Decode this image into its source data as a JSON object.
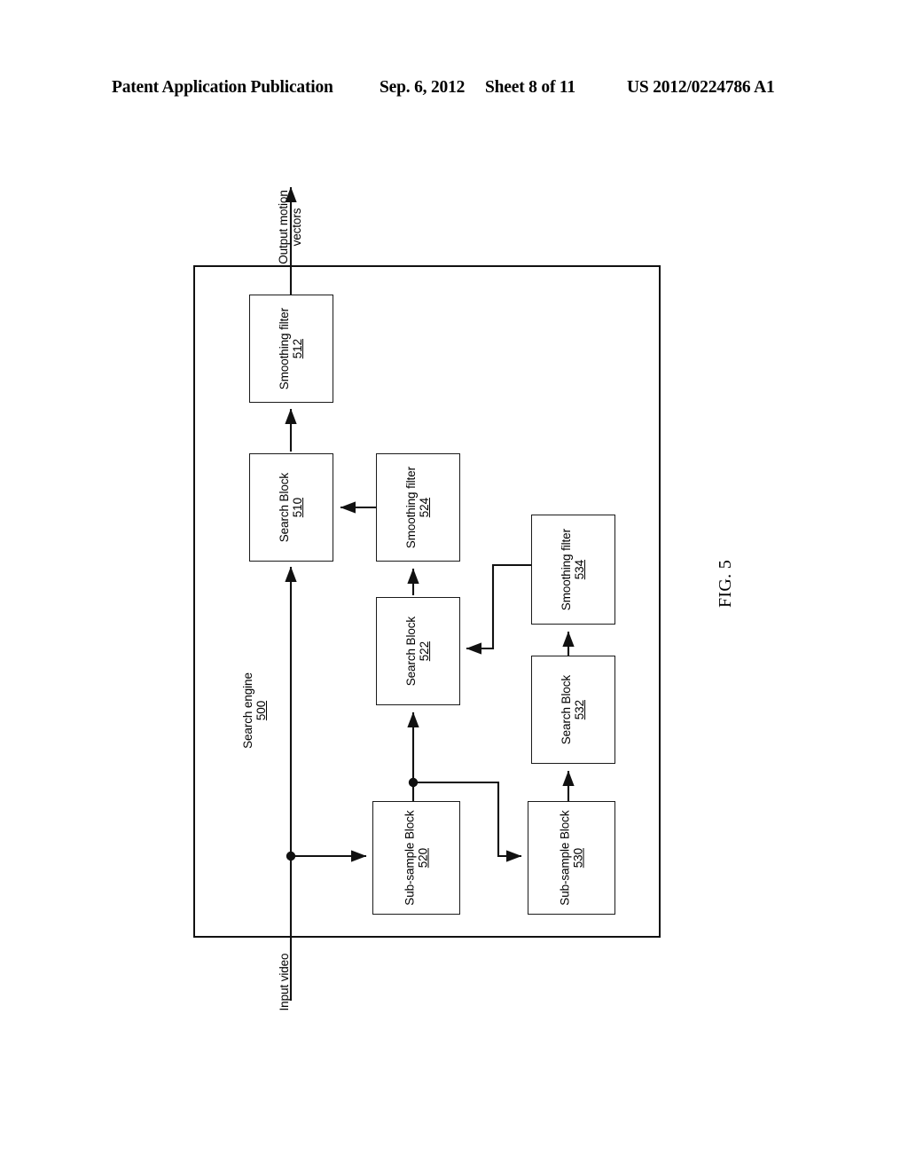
{
  "header": {
    "publication": "Patent Application Publication",
    "date": "Sep. 6, 2012",
    "sheet": "Sheet 8 of 11",
    "number": "US 2012/0224786 A1"
  },
  "figure": {
    "caption": "FIG. 5",
    "container": {
      "name": "Search engine",
      "ref": "500"
    },
    "io_labels": {
      "output": "Output motion\nvectors",
      "output_line1": "Output motion",
      "output_line2": "vectors",
      "input": "Input video"
    },
    "blocks": [
      {
        "id": "smoothing-filter-512",
        "name": "Smoothing filter",
        "ref": "512"
      },
      {
        "id": "search-block-510",
        "name": "Search Block",
        "ref": "510"
      },
      {
        "id": "smoothing-filter-524",
        "name": "Smoothing filter",
        "ref": "524"
      },
      {
        "id": "smoothing-filter-534",
        "name": "Smoothing filter",
        "ref": "534"
      },
      {
        "id": "search-block-522",
        "name": "Search Block",
        "ref": "522"
      },
      {
        "id": "search-block-532",
        "name": "Search Block",
        "ref": "532"
      },
      {
        "id": "sub-sample-block-520",
        "name": "Sub-sample Block",
        "ref": "520"
      },
      {
        "id": "sub-sample-block-530",
        "name": "Sub-sample Block",
        "ref": "530"
      }
    ],
    "connections": [
      {
        "from": "smoothing-filter-512",
        "to": "output-motion-vectors"
      },
      {
        "from": "search-block-510",
        "to": "smoothing-filter-512"
      },
      {
        "from": "smoothing-filter-524",
        "to": "search-block-510"
      },
      {
        "from": "search-block-522",
        "to": "smoothing-filter-524"
      },
      {
        "from": "smoothing-filter-534",
        "to": "search-block-522"
      },
      {
        "from": "search-block-532",
        "to": "smoothing-filter-534"
      },
      {
        "from": "sub-sample-block-520",
        "to": "search-block-522"
      },
      {
        "from": "sub-sample-block-530",
        "to": "search-block-532"
      },
      {
        "from": "input-video",
        "to": "search-block-510"
      },
      {
        "from": "input-video",
        "to": "sub-sample-block-520"
      },
      {
        "from": "sub-sample-block-520",
        "to": "sub-sample-block-530"
      }
    ]
  },
  "colors": {
    "ink": "#111111",
    "paper": "#ffffff"
  }
}
